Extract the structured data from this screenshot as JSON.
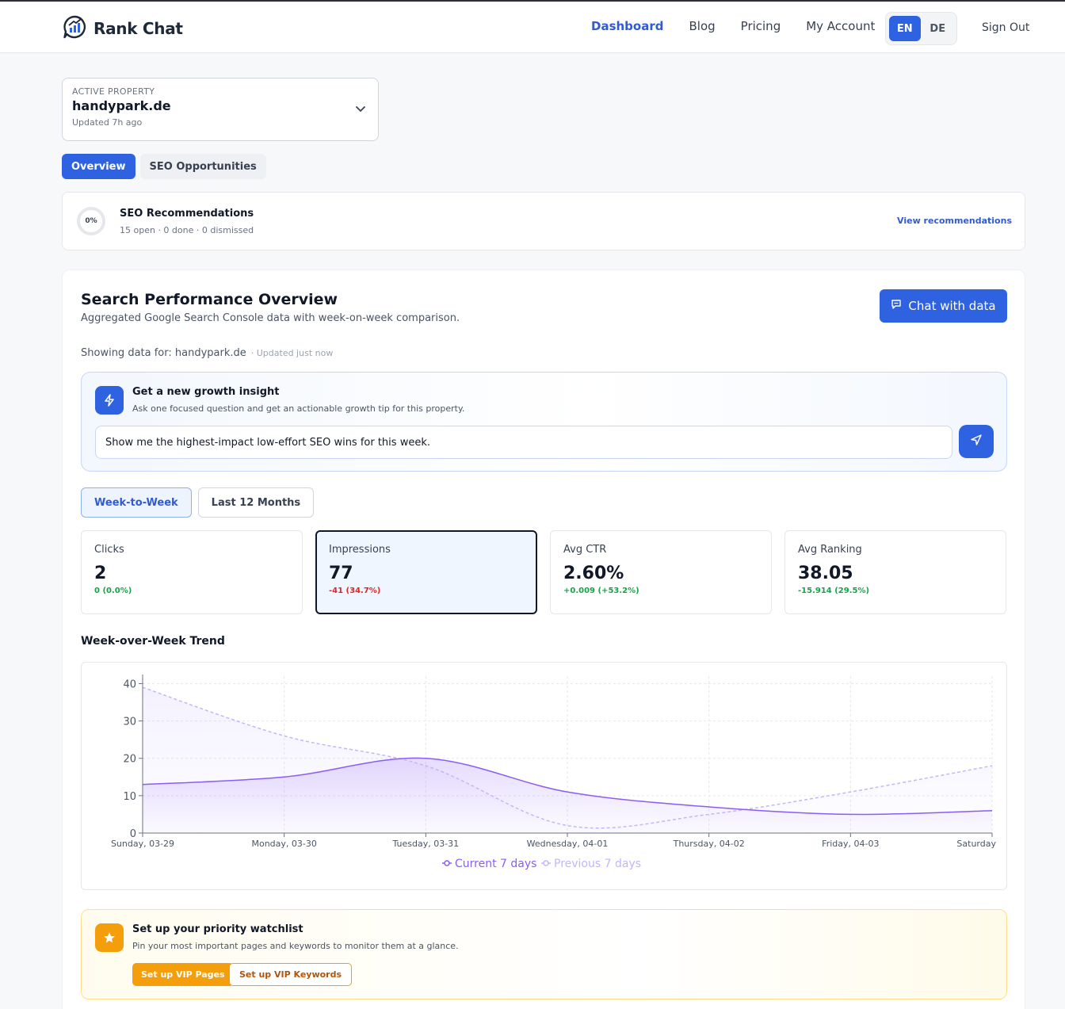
{
  "header": {
    "brand": "Rank Chat",
    "nav": [
      "Dashboard",
      "Blog",
      "Pricing",
      "My Account"
    ],
    "active_nav": "Dashboard",
    "languages": [
      "EN",
      "DE"
    ],
    "active_language": "EN",
    "sign_out": "Sign Out"
  },
  "property": {
    "caption": "ACTIVE PROPERTY",
    "name": "handypark.de",
    "updated": "Updated 7h ago"
  },
  "tabs": [
    "Overview",
    "SEO Opportunities"
  ],
  "recommendations": {
    "progress": "0%",
    "title": "SEO Recommendations",
    "summary": "15 open · 0 done · 0 dismissed",
    "link": "View recommendations"
  },
  "overview": {
    "title": "Search Performance Overview",
    "subtitle": "Aggregated Google Search Console data with week-on-week comparison.",
    "chat_button": "Chat with data",
    "showing": "Showing data for: handypark.de",
    "updated": "· Updated just now"
  },
  "insight": {
    "title": "Get a new growth insight",
    "subtitle": "Ask one focused question and get an actionable growth tip for this property.",
    "input_value": "Show me the highest-impact low-effort SEO wins for this week."
  },
  "ranges": [
    "Week-to-Week",
    "Last 12 Months"
  ],
  "metrics": [
    {
      "label": "Clicks",
      "value": "2",
      "delta": "0 (0.0%)",
      "trend": "pos"
    },
    {
      "label": "Impressions",
      "value": "77",
      "delta": "-41 (34.7%)",
      "trend": "neg"
    },
    {
      "label": "Avg CTR",
      "value": "2.60%",
      "delta": "+0.009 (+53.2%)",
      "trend": "pos"
    },
    {
      "label": "Avg Ranking",
      "value": "38.05",
      "delta": "-15.914 (29.5%)",
      "trend": "pos"
    }
  ],
  "trend_title": "Week-over-Week Trend",
  "chart_data": {
    "type": "area",
    "categories": [
      "Sunday, 03-29",
      "Monday, 03-30",
      "Tuesday, 03-31",
      "Wednesday, 04-01",
      "Thursday, 04-02",
      "Friday, 04-03",
      "Saturday"
    ],
    "yticks": [
      0,
      10,
      20,
      30,
      40
    ],
    "ylim": [
      0,
      42
    ],
    "series": [
      {
        "name": "Current 7 days",
        "values": [
          13,
          15,
          20,
          11,
          7,
          5,
          6
        ],
        "color": "#8b5cf6",
        "style": "solid"
      },
      {
        "name": "Previous 7 days",
        "values": [
          39,
          26,
          18,
          2,
          5,
          11,
          18
        ],
        "color": "#c4b5fd",
        "style": "dashed"
      }
    ],
    "grid": true,
    "legend": "bottom-center"
  },
  "watchlist": {
    "title": "Set up your priority watchlist",
    "subtitle": "Pin your most important pages and keywords to monitor them at a glance.",
    "btn_pages": "Set up VIP Pages",
    "btn_keywords": "Set up VIP Keywords"
  },
  "colors": {
    "primary": "#2f62e0",
    "accent_orange": "#f59e0b",
    "positive": "#16a34a",
    "negative": "#dc2626"
  }
}
